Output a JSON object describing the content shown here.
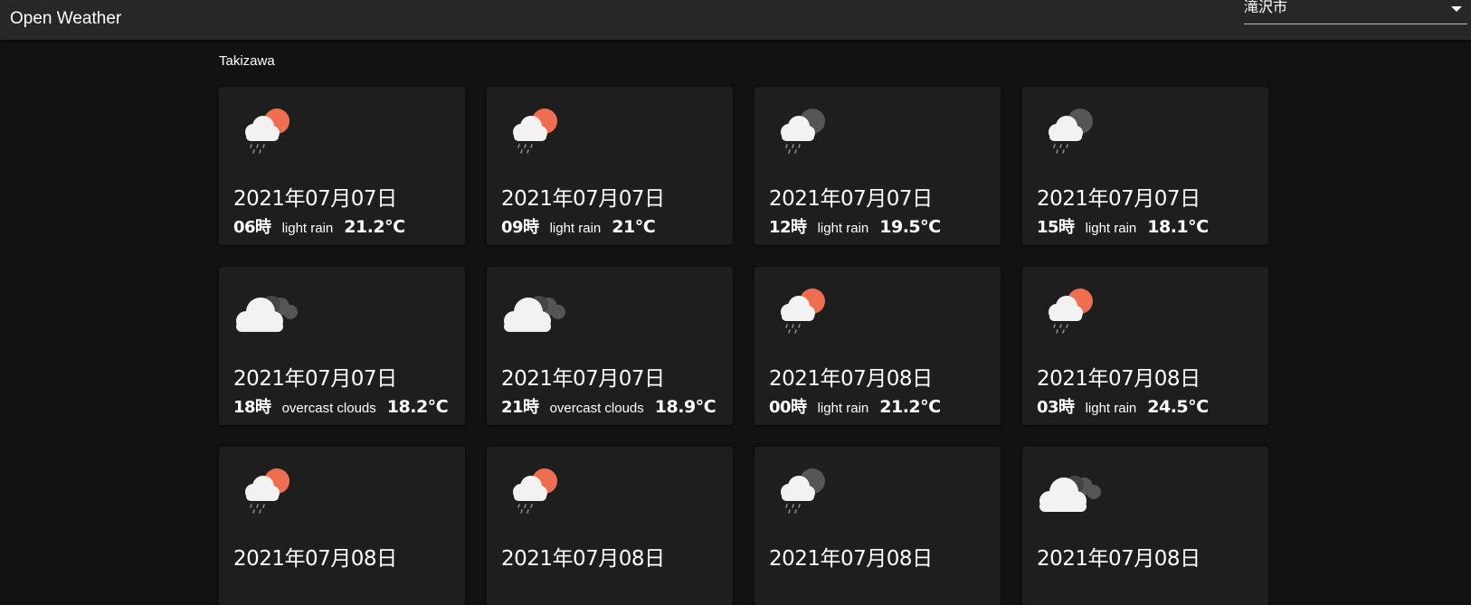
{
  "header": {
    "title": "Open Weather",
    "city_select": {
      "value": "滝沢市"
    }
  },
  "location": "Takizawa",
  "colors": {
    "sun": "#ee6e4f",
    "dark_cloud": "#555555",
    "cloud": "#f2f2f2",
    "rain": "#888888"
  },
  "forecasts": [
    {
      "date": "2021年07月07日",
      "hour": "06時",
      "description": "light rain",
      "temp": "21.2℃",
      "icon": "rain-sun-icon"
    },
    {
      "date": "2021年07月07日",
      "hour": "09時",
      "description": "light rain",
      "temp": "21℃",
      "icon": "rain-sun-icon"
    },
    {
      "date": "2021年07月07日",
      "hour": "12時",
      "description": "light rain",
      "temp": "19.5℃",
      "icon": "rain-moon-icon"
    },
    {
      "date": "2021年07月07日",
      "hour": "15時",
      "description": "light rain",
      "temp": "18.1℃",
      "icon": "rain-moon-icon"
    },
    {
      "date": "2021年07月07日",
      "hour": "18時",
      "description": "overcast clouds",
      "temp": "18.2℃",
      "icon": "overcast-clouds-icon"
    },
    {
      "date": "2021年07月07日",
      "hour": "21時",
      "description": "overcast clouds",
      "temp": "18.9℃",
      "icon": "overcast-clouds-icon"
    },
    {
      "date": "2021年07月08日",
      "hour": "00時",
      "description": "light rain",
      "temp": "21.2℃",
      "icon": "rain-sun-icon"
    },
    {
      "date": "2021年07月08日",
      "hour": "03時",
      "description": "light rain",
      "temp": "24.5℃",
      "icon": "rain-sun-icon"
    },
    {
      "date": "2021年07月08日",
      "icon": "rain-sun-icon"
    },
    {
      "date": "2021年07月08日",
      "icon": "rain-sun-icon"
    },
    {
      "date": "2021年07月08日",
      "icon": "rain-moon-icon"
    },
    {
      "date": "2021年07月08日",
      "icon": "overcast-clouds-icon"
    }
  ]
}
